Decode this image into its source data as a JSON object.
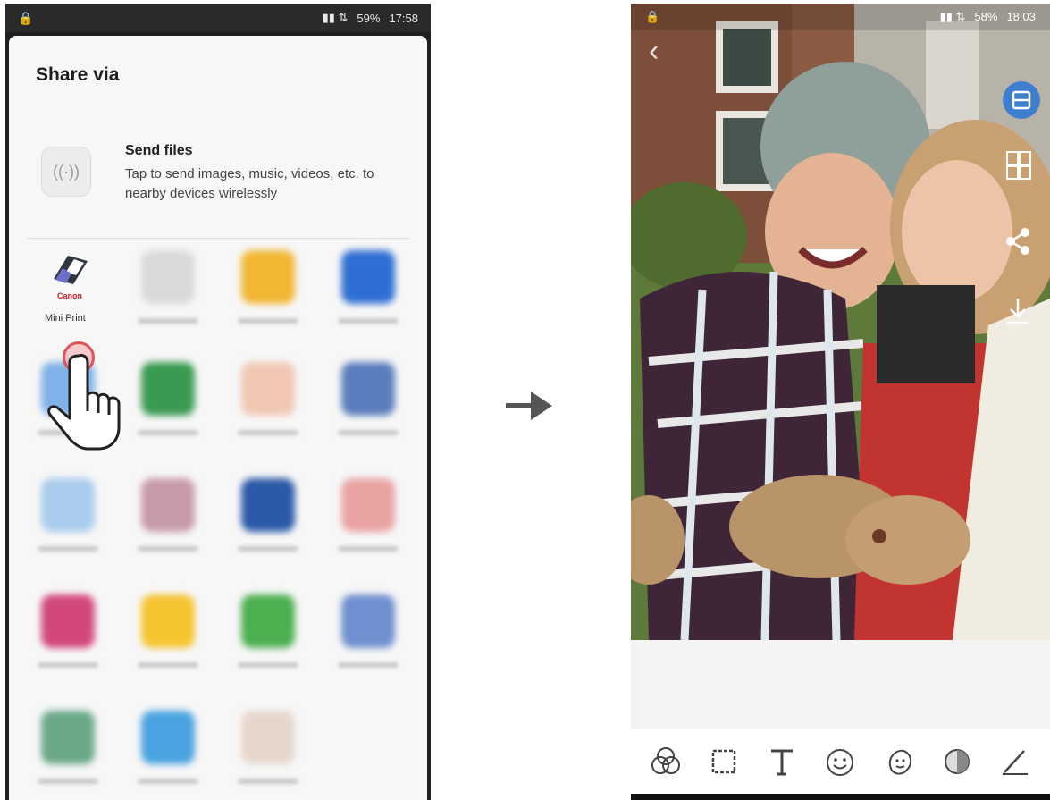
{
  "left_phone": {
    "status": {
      "time": "17:58",
      "battery": "59%"
    },
    "share_title": "Share via",
    "send_files": {
      "title": "Send files",
      "description": "Tap to send images, music, videos, etc. to nearby devices wirelessly"
    },
    "canon_app": {
      "brand": "Canon",
      "label": "Mini Print"
    }
  },
  "right_phone": {
    "status": {
      "time": "18:03",
      "battery": "58%"
    },
    "side_tools": [
      "print-icon",
      "collage-icon",
      "share-icon",
      "download-icon"
    ],
    "bottom_tools": [
      "filters-icon",
      "frame-icon",
      "text-icon",
      "sticker-icon",
      "face-sticker-icon",
      "adjust-icon",
      "pen-icon"
    ]
  },
  "colors": {
    "accent_blue": "#3f7fd0",
    "tap_red": "#e44f58",
    "canon_red": "#cc1f2a"
  }
}
